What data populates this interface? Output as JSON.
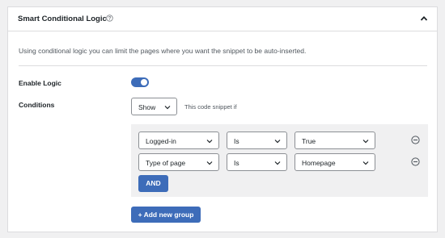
{
  "panel": {
    "title": "Smart Conditional Logic",
    "description": "Using conditional logic you can limit the pages where you want the snippet to be auto-inserted."
  },
  "enable_logic": {
    "label": "Enable Logic",
    "enabled": true
  },
  "conditions": {
    "label": "Conditions",
    "mode": "Show",
    "hint": "This code snippet if",
    "rules": [
      {
        "field": "Logged-in",
        "operator": "Is",
        "value": "True"
      },
      {
        "field": "Type of page",
        "operator": "Is",
        "value": "Homepage"
      }
    ],
    "and_label": "AND",
    "add_group_label": "+ Add new group"
  },
  "colors": {
    "accent": "#3d6cb9",
    "background": "#f0f0f1"
  },
  "icons": {
    "help": "help-circle-icon",
    "collapse": "chevron-up-icon",
    "dropdown": "chevron-down-icon",
    "remove": "minus-circle-icon"
  }
}
